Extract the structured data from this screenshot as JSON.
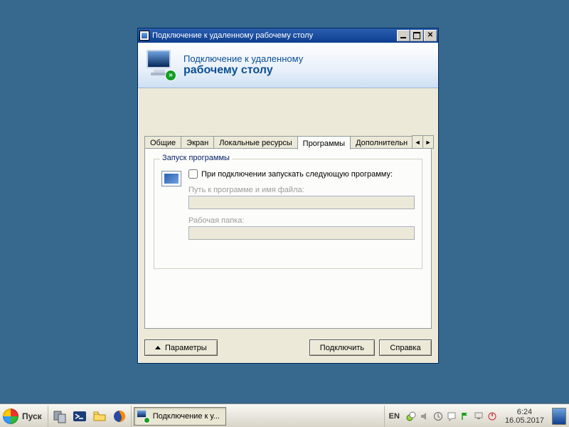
{
  "window": {
    "title": "Подключение к удаленному рабочему столу",
    "header_line1": "Подключение к удаленному",
    "header_line2": "рабочему столу"
  },
  "tabs": {
    "items": [
      "Общие",
      "Экран",
      "Локальные ресурсы",
      "Программы",
      "Дополнительн"
    ],
    "active_index": 3
  },
  "group": {
    "title": "Запуск программы",
    "checkbox_label": "При подключении запускать следующую программу:",
    "checkbox_checked": false,
    "path_label": "Путь к программе и имя файла:",
    "path_value": "",
    "folder_label": "Рабочая папка:",
    "folder_value": ""
  },
  "buttons": {
    "options": "Параметры",
    "connect": "Подключить",
    "help": "Справка"
  },
  "taskbar": {
    "start": "Пуск",
    "task_button": "Подключение к у...",
    "lang": "EN",
    "time": "6:24",
    "date": "16.05.2017"
  }
}
